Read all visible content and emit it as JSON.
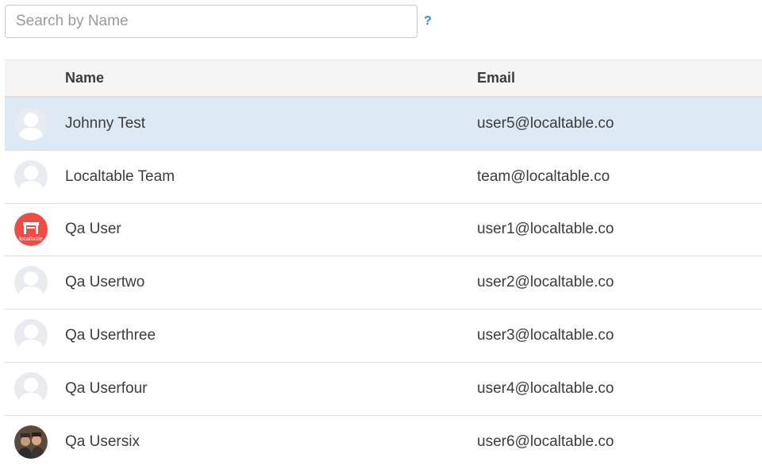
{
  "search": {
    "placeholder": "Search by Name",
    "value": ""
  },
  "help": {
    "label": "?",
    "icon": "question-mark-icon",
    "color": "#2a8fd0"
  },
  "table": {
    "columns": [
      "Name",
      "Email"
    ],
    "selected_row_color": "#dde9f4",
    "rows": [
      {
        "name": "Johnny Test",
        "email": "user5@localtable.co",
        "avatar": "default-avatar-icon",
        "selected": true
      },
      {
        "name": "Localtable Team",
        "email": "team@localtable.co",
        "avatar": "default-avatar-icon",
        "selected": false
      },
      {
        "name": "Qa User",
        "email": "user1@localtable.co",
        "avatar": "localtable-logo-avatar",
        "avatar_text": "localtable",
        "selected": false
      },
      {
        "name": "Qa Usertwo",
        "email": "user2@localtable.co",
        "avatar": "default-avatar-icon",
        "selected": false
      },
      {
        "name": "Qa Userthree",
        "email": "user3@localtable.co",
        "avatar": "default-avatar-icon",
        "selected": false
      },
      {
        "name": "Qa Userfour",
        "email": "user4@localtable.co",
        "avatar": "default-avatar-icon",
        "selected": false
      },
      {
        "name": "Qa Usersix",
        "email": "user6@localtable.co",
        "avatar": "photo-avatar",
        "selected": false
      }
    ]
  }
}
